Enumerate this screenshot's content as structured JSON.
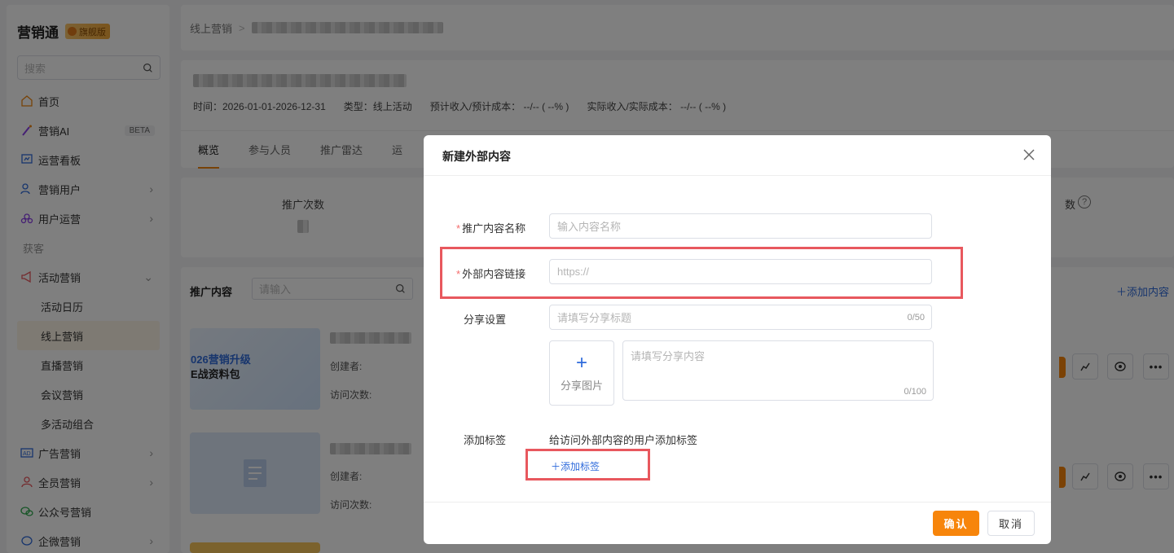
{
  "sidebar": {
    "brand": "营销通",
    "edition": "旗舰版",
    "search_placeholder": "搜索",
    "items": [
      {
        "label": "首页",
        "icon": "home-icon"
      },
      {
        "label": "营销AI",
        "icon": "ai-wand-icon",
        "badge": "BETA"
      },
      {
        "label": "运营看板",
        "icon": "dashboard-icon"
      },
      {
        "label": "营销用户",
        "icon": "users-icon"
      },
      {
        "label": "用户运营",
        "icon": "user-ops-icon"
      }
    ],
    "section_acquire": "获客",
    "activity": {
      "label": "活动营销",
      "icon": "megaphone-icon"
    },
    "activity_sub": [
      "活动日历",
      "线上营销",
      "直播营销",
      "会议营销",
      "多活动组合"
    ],
    "more_items": [
      {
        "label": "广告营销",
        "icon": "ad-icon"
      },
      {
        "label": "全员营销",
        "icon": "team-icon"
      },
      {
        "label": "公众号营销",
        "icon": "wechat-icon"
      },
      {
        "label": "企微营销",
        "icon": "wecom-icon"
      }
    ]
  },
  "breadcrumb": {
    "root": "线上营销",
    "separator": ">"
  },
  "header": {
    "time": "时间：2026-01-01-2026-12-31",
    "type": "类型：线上活动",
    "expected": "预计收入/预计成本： --/-- ( --% )",
    "actual": "实际收入/实际成本： --/-- ( --% )",
    "tabs": [
      "概览",
      "参与人员",
      "推广雷达",
      "运"
    ]
  },
  "stats": {
    "promo_count_label": "推广次数",
    "right_label": "数"
  },
  "content": {
    "title": "推广内容",
    "search_placeholder": "请输入",
    "add_label": "添加内容",
    "item1_banner_line1": "026营销升级",
    "item1_banner_line2": "E战资料包",
    "creator_label": "创建者:",
    "visits_label": "访问次数:"
  },
  "dialog": {
    "title": "新建外部内容",
    "name_label": "推广内容名称",
    "name_placeholder": "输入内容名称",
    "link_label": "外部内容链接",
    "link_placeholder": "https://",
    "share_label": "分享设置",
    "share_title_placeholder": "请填写分享标题",
    "share_title_count": "0/50",
    "share_image_label": "分享图片",
    "share_content_placeholder": "请填写分享内容",
    "share_content_count": "0/100",
    "tag_label": "添加标签",
    "tag_hint": "给访问外部内容的用户添加标签",
    "add_tag": "添加标签",
    "confirm": "确认",
    "cancel": "取消"
  },
  "colors": {
    "accent": "#f7850b",
    "link": "#2f6bdb",
    "highlight": "#e8585e",
    "required": "#f56c6c"
  }
}
